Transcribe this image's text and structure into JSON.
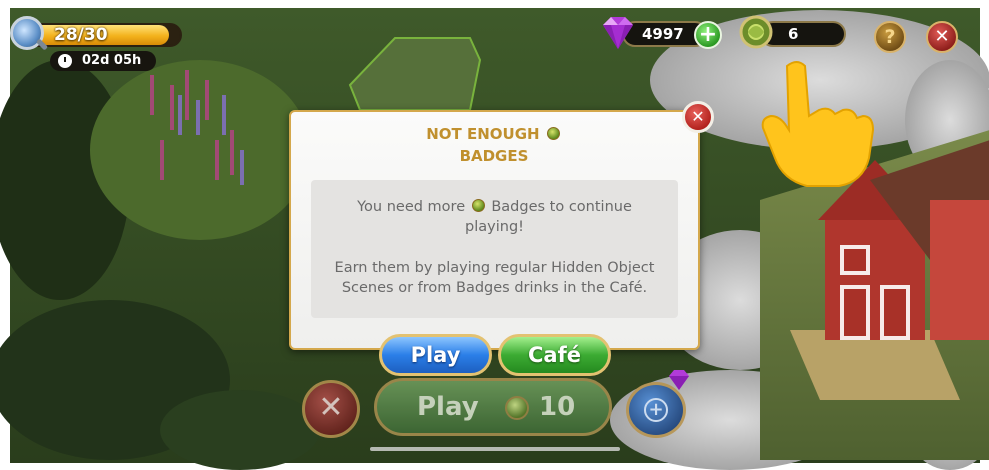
{
  "hud": {
    "energy": {
      "text": "28/30",
      "fill_fraction": 0.93
    },
    "timer": {
      "text": "02d 05h"
    },
    "gems": {
      "count": "4997"
    },
    "badges": {
      "count": "6"
    }
  },
  "dialog": {
    "title_line1": "NOT ENOUGH",
    "title_line2": "BADGES",
    "message_before_icon": "You need more",
    "message_after_icon": "Badges to continue playing!",
    "message2": "Earn them by playing regular Hidden Object Scenes or from Badges drinks in the Café.",
    "play_button": "Play",
    "cafe_button": "Café"
  },
  "bottom": {
    "play_label": "Play",
    "play_cost": "10"
  },
  "icons": {
    "magnifier": "magnifier-icon",
    "timer": "stopwatch-icon",
    "gem": "purple-gem-icon",
    "badge": "badge-icon",
    "help": "question-icon",
    "close": "close-icon",
    "pointer": "pointing-hand-icon",
    "boost": "boost-icon"
  },
  "colors": {
    "gold_text": "#c0902e",
    "play_blue": "#2b7fe8",
    "cafe_green": "#3cab33",
    "energy_yellow": "#f3b21c",
    "close_red": "#b01f1a"
  }
}
